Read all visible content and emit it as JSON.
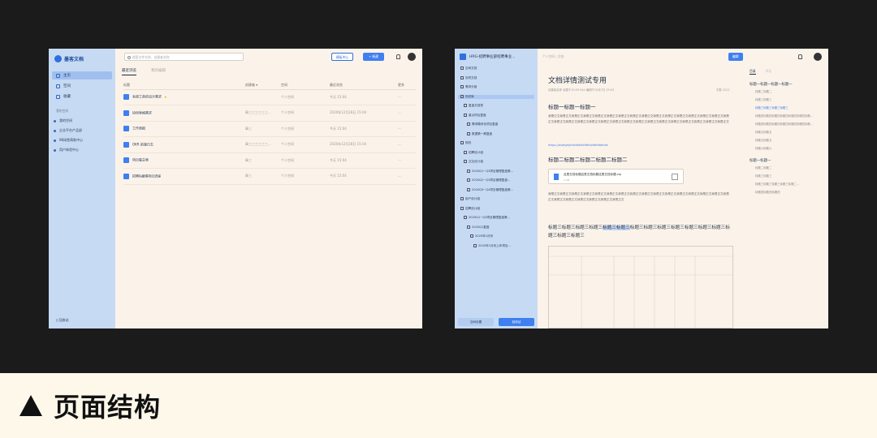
{
  "app": {
    "logo_text": "墨客文档",
    "nav": [
      "主页",
      "空间",
      "收藏"
    ],
    "group_title": "我的空间",
    "spaces": [
      "我的空间",
      "企业平台产品部",
      "98闲鱼帮助中心",
      "用户体验中心"
    ],
    "trash": "回收站",
    "search_placeholder": "搜索文件名称、创建者名称",
    "template_center": "模板中心",
    "new_button": "+ 新建",
    "tabs": [
      "最近浏览",
      "我的编辑"
    ],
    "columns": [
      "标题",
      "创建者 ▾",
      "空间",
      "最近浏览",
      "更多"
    ],
    "rows": [
      {
        "title": "系统工具积设计需求",
        "starred": true,
        "creator": "",
        "space": "个人空间",
        "time": "今天 15:04"
      },
      {
        "title": "协同表格需求",
        "starred": false,
        "creator": "章三三三三三三...",
        "space": "个人空间",
        "time": "2020年12月28日 15:04"
      },
      {
        "title": "工作周报",
        "starred": false,
        "creator": "章三",
        "space": "个人空间",
        "time": "今天 15:04"
      },
      {
        "title": "OKR 前端日志",
        "starred": false,
        "creator": "章三三三三三三...",
        "space": "个人空间",
        "time": "2020年12月28日 15:04"
      },
      {
        "title": "项目看总表",
        "starred": false,
        "creator": "章三",
        "space": "个人空间",
        "time": "今天 15:04"
      },
      {
        "title": "招聘&编辑项目流程",
        "starred": false,
        "creator": "章三",
        "space": "个人空间",
        "time": "今天 15:04"
      }
    ],
    "more_glyph": "···"
  },
  "doc": {
    "workspace": "HRG-招聘事业部招聘事业...",
    "tree": [
      "空间文档",
      "协同文档",
      "需求分组",
      "知识库",
      "复盘文档表",
      "重点项目复盘",
      "需求模块化项目复盘",
      "数据第一期复盘",
      "规划",
      "招聘设计组",
      "交互设计组",
      "2020Q1~Q3项目管理复盘第...",
      "2020Q2~Q3项目管理复盘...",
      "2020Q3~Q4项目管理复盘第...",
      "用户设计组",
      "招聘设计组",
      "2020Q1~Q3项目管理复盘第...",
      "2020Q1复盘",
      "2020年1月份",
      "2020年1月份上年项目..."
    ],
    "space_settings": "空间设置",
    "trash": "回收站",
    "breadcrumb": "个人空间 / 文档",
    "edit_button": "编辑",
    "title": "文档详情测试专用",
    "meta": "创建者名称 创建于10:00    Hyh  编辑于10月7日 15:03",
    "word_count": "字数 2222",
    "h1": "标题一标题一标题一",
    "para1": "我是正文我是正文我是正文我是正文我是正文我是正文我是正文我是正文我是正文我是正文我是正文我是正文我是正文我是正文我是正文我是正文我是正文我是正文我是正文我是正文我是正文我是正文我是正文我是正文我是正文我是正文我是正文我是正文我是正文我是正文我是正文",
    "link": "https://asdfghjhfskfddfskfdfksfdfdfddkfds",
    "h2": "标题二标题二标题二标题二标题二",
    "attachment_name": "这是文档标题这是文档标题这是文档标题.zip",
    "attachment_size": "2.3M",
    "para2": "我是正文我是正文我是正文我是正文我是正文我是正文我是正文我是正文我是正文我是正文我是正文我是正文我是正文我是正文我是正文我是正文我是正文我是正文我是正文我是正文我是正文我是正文",
    "h3_pre": "标题三标题三标题三标题三",
    "h3_hl": "标题三标题三",
    "h3_post": "标题三标题三标题三标题三标题三标题三标题三标题三标题三标题三",
    "toc_tabs": [
      "目录",
      "评论"
    ],
    "toc": [
      {
        "t": "标题一标题一标题一标题一",
        "lvl": "big"
      },
      {
        "t": "标题二标题二",
        "lvl": "sub"
      },
      {
        "t": "标题三标题三",
        "lvl": "sub"
      },
      {
        "t": "标题三标题三标题三标题三",
        "lvl": "cur"
      },
      {
        "t": "标题四标题四标题四标题四标题四标题四标题...",
        "lvl": "sub"
      },
      {
        "t": "标题四标题四标题四标题四标题四标题四标题...",
        "lvl": "sub"
      },
      {
        "t": "标题五标题五",
        "lvl": "sub"
      },
      {
        "t": "标题五标题五",
        "lvl": "sub"
      },
      {
        "t": "标题六标题六",
        "lvl": "sub"
      },
      {
        "t": "标题一标题一",
        "lvl": "big"
      },
      {
        "t": "标题二标题二",
        "lvl": "sub"
      },
      {
        "t": "标题三标题三",
        "lvl": "sub"
      },
      {
        "t": "标题三标题三标题三标题三标题二...",
        "lvl": "sub"
      },
      {
        "t": "标题四标题四标题四",
        "lvl": "sub"
      }
    ]
  },
  "caption": "页面结构",
  "colors": {
    "accent": "#3f7ff0",
    "sidebar": "#c7daf3",
    "canvas": "#fbf3ea"
  }
}
